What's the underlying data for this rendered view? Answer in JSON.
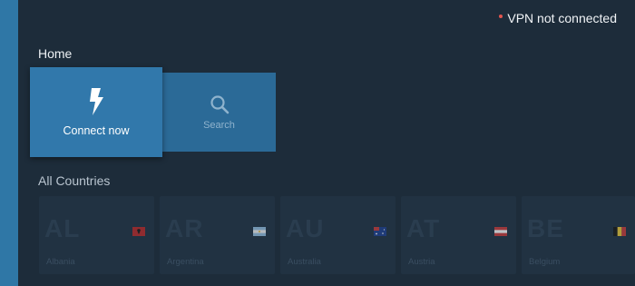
{
  "status": {
    "text": "VPN not connected",
    "dot_color": "#e2554f"
  },
  "home": {
    "title": "Home",
    "tiles": [
      {
        "label": "Connect now",
        "icon": "lightning-bolt-icon"
      },
      {
        "label": "Search",
        "icon": "search-icon"
      }
    ]
  },
  "countries": {
    "title": "All Countries",
    "items": [
      {
        "code": "AL",
        "name": "Albania",
        "flag": "albania-flag-icon"
      },
      {
        "code": "AR",
        "name": "Argentina",
        "flag": "argentina-flag-icon"
      },
      {
        "code": "AU",
        "name": "Australia",
        "flag": "australia-flag-icon"
      },
      {
        "code": "AT",
        "name": "Austria",
        "flag": "austria-flag-icon"
      },
      {
        "code": "BE",
        "name": "Belgium",
        "flag": "belgium-flag-icon"
      }
    ]
  },
  "colors": {
    "accent": "#3178ab",
    "background": "#1d2c3a",
    "rail": "#2f77a6"
  }
}
